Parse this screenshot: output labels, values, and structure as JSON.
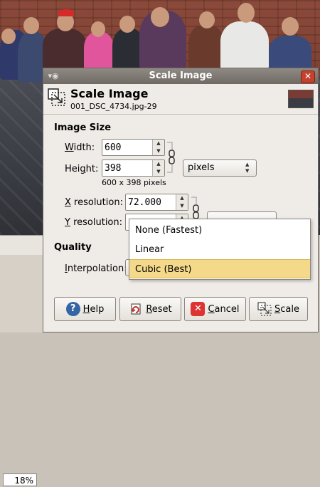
{
  "canvas": {
    "zoom_value": "18%"
  },
  "dialog": {
    "window_title": "Scale Image",
    "header": {
      "title": "Scale Image",
      "subtitle": "001_DSC_4734.jpg-29"
    },
    "image_size": {
      "section_label": "Image Size",
      "width_label_prefix": "W",
      "width_label_rest": "idth:",
      "width_value": "600",
      "height_label_pre": "Hei",
      "height_label_key": "g",
      "height_label_post": "ht:",
      "height_value": "398",
      "unit_combo": "pixels",
      "size_readout": "600 x 398 pixels",
      "xres_label_key": "X",
      "xres_label_rest": " resolution:",
      "xres_value": "72.000",
      "yres_label_key": "Y",
      "yres_label_rest": " resolution:"
    },
    "quality": {
      "section_label": "Quality",
      "interp_label_pre": "",
      "interp_label_key": "I",
      "interp_label_rest": "nterpolation:",
      "options": [
        {
          "label": "None (Fastest)"
        },
        {
          "label": "Linear"
        },
        {
          "label": "Cubic (Best)"
        }
      ],
      "selected_index": 2
    },
    "buttons": {
      "help": {
        "key": "H",
        "rest": "elp"
      },
      "reset": {
        "key": "R",
        "rest": "eset"
      },
      "cancel": {
        "key": "C",
        "rest": "ancel"
      },
      "scale": {
        "key": "S",
        "rest": "cale"
      }
    },
    "colors": {
      "selection": "#f5d98a",
      "close_button": "#c7402c",
      "titlebar": "#7f7a73"
    }
  }
}
